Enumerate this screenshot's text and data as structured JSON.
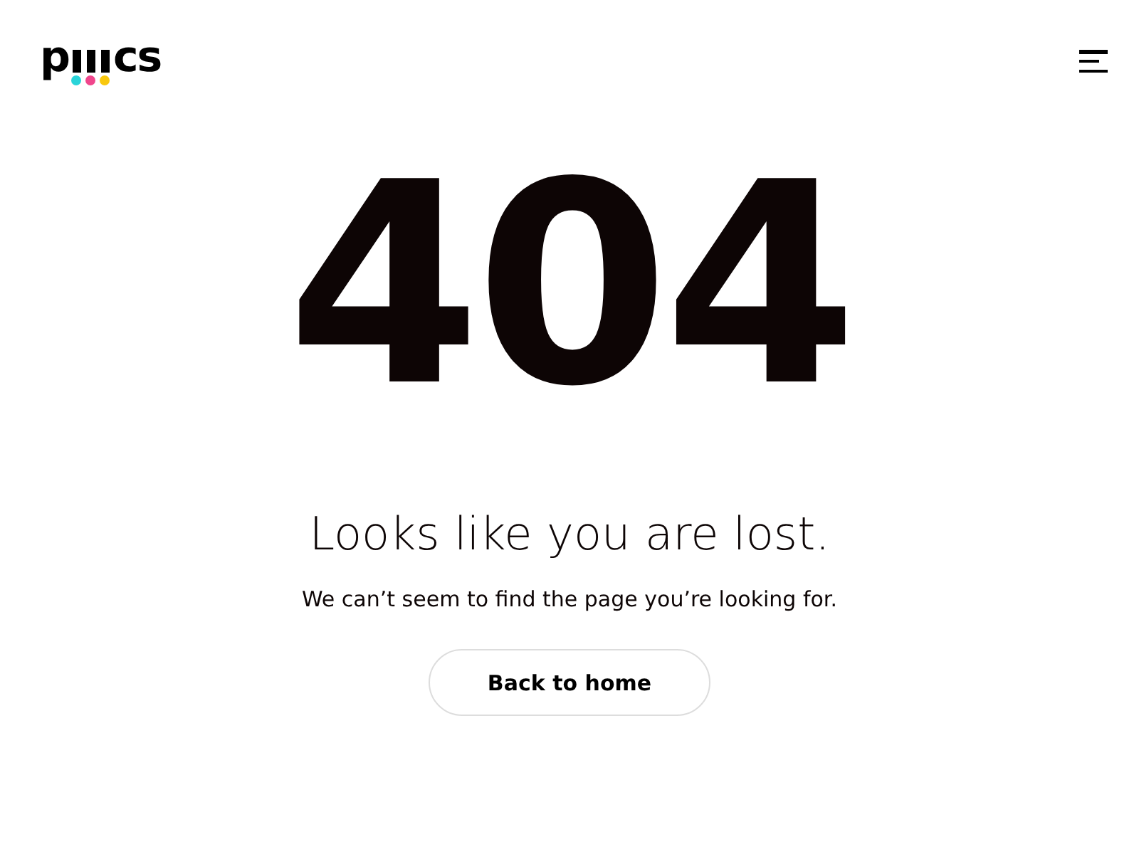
{
  "logo": {
    "start": "p",
    "end": "cs",
    "dots": [
      {
        "color": "#2ad4d9"
      },
      {
        "color": "#f0468c"
      },
      {
        "color": "#f9c80e"
      }
    ]
  },
  "code": "404",
  "heading": "Looks like you are lost.",
  "message": "We can’t seem to find the page you’re looking for.",
  "button": "Back to home"
}
